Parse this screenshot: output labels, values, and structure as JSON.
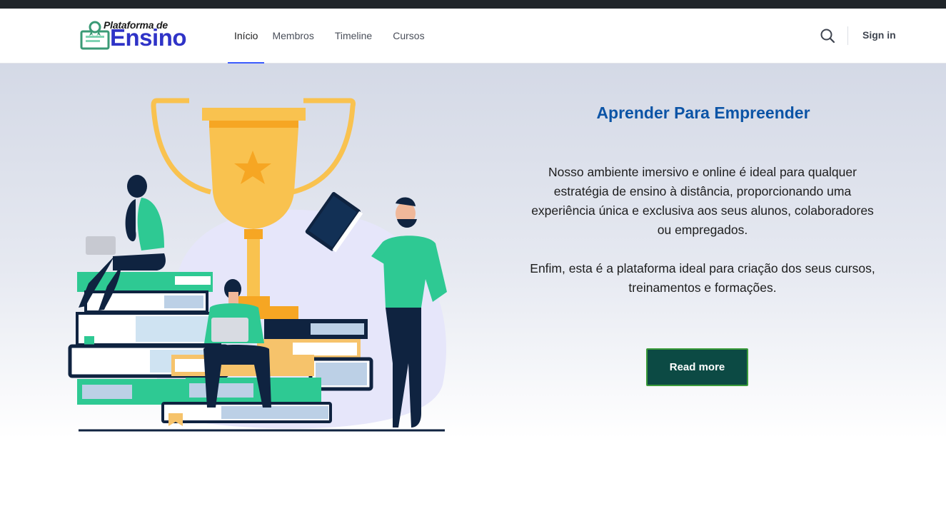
{
  "header": {
    "logo_top": "Plataforma de",
    "logo_main": "Ensino",
    "nav": [
      {
        "label": "Início"
      },
      {
        "label": "Membros"
      },
      {
        "label": "Timeline"
      },
      {
        "label": "Cursos"
      }
    ],
    "active_nav": "Início",
    "search_icon": "search-icon",
    "signin_label": "Sign in"
  },
  "hero": {
    "title": "Aprender Para Empreender",
    "paragraphs": [
      "Nosso ambiente imersivo e online é ideal para qualquer estratégia de ensino à distância, proporcionando uma experiência única e exclusiva aos seus alunos, colaboradores ou empregados.",
      "Enfim, esta é a plataforma ideal para criação dos seus cursos, treinamentos e formações."
    ],
    "button_label": "Read more"
  },
  "colors": {
    "brand": "#2f33c7",
    "title": "#0c54a6",
    "button_bg": "#0c4a44",
    "button_border": "#3b9b3b",
    "nav_active_underline": "#3c5cff",
    "top_strip": "#1f2429"
  }
}
